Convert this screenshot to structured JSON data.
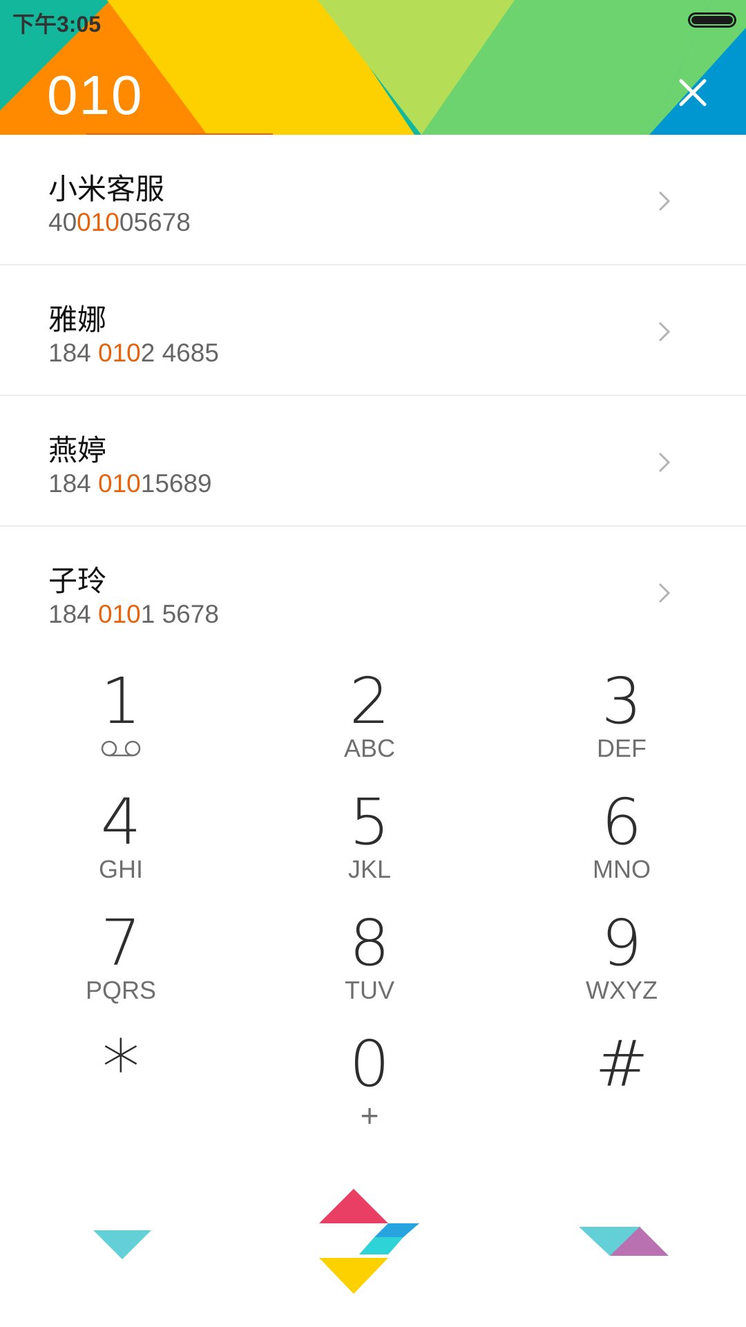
{
  "status_bar": {
    "time": "下午3:05"
  },
  "dialer": {
    "number": "010"
  },
  "contacts": [
    {
      "name": "小米客服",
      "number_parts": [
        "40",
        "010",
        "05678"
      ]
    },
    {
      "name": "雅娜",
      "number_parts": [
        "184 ",
        "010",
        "2 4685"
      ]
    },
    {
      "name": "燕婷",
      "number_parts": [
        "184 ",
        "010",
        "15689"
      ]
    },
    {
      "name": "子玲",
      "number_parts": [
        "184 ",
        "010",
        "1 5678"
      ]
    }
  ],
  "keypad": [
    {
      "digit": "1",
      "letters": ""
    },
    {
      "digit": "2",
      "letters": "ABC"
    },
    {
      "digit": "3",
      "letters": "DEF"
    },
    {
      "digit": "4",
      "letters": "GHI"
    },
    {
      "digit": "5",
      "letters": "JKL"
    },
    {
      "digit": "6",
      "letters": "MNO"
    },
    {
      "digit": "7",
      "letters": "PQRS"
    },
    {
      "digit": "8",
      "letters": "TUV"
    },
    {
      "digit": "9",
      "letters": "WXYZ"
    },
    {
      "digit": "*",
      "letters": ""
    },
    {
      "digit": "0",
      "letters": "+"
    },
    {
      "digit": "#",
      "letters": ""
    }
  ],
  "colors": {
    "highlight": "#e8620c",
    "header_teal": "#13b89c",
    "header_orange": "#ff8a00",
    "header_yellow": "#fdd000",
    "header_lime": "#b5de56",
    "header_green": "#6cd36f",
    "header_blue": "#0097d0"
  },
  "icons": {
    "voicemail": "voicemail-icon",
    "close": "close-icon",
    "chevron": "chevron-right-icon",
    "collapse": "collapse-keypad-icon",
    "call": "call-icon",
    "menu": "menu-icon"
  }
}
